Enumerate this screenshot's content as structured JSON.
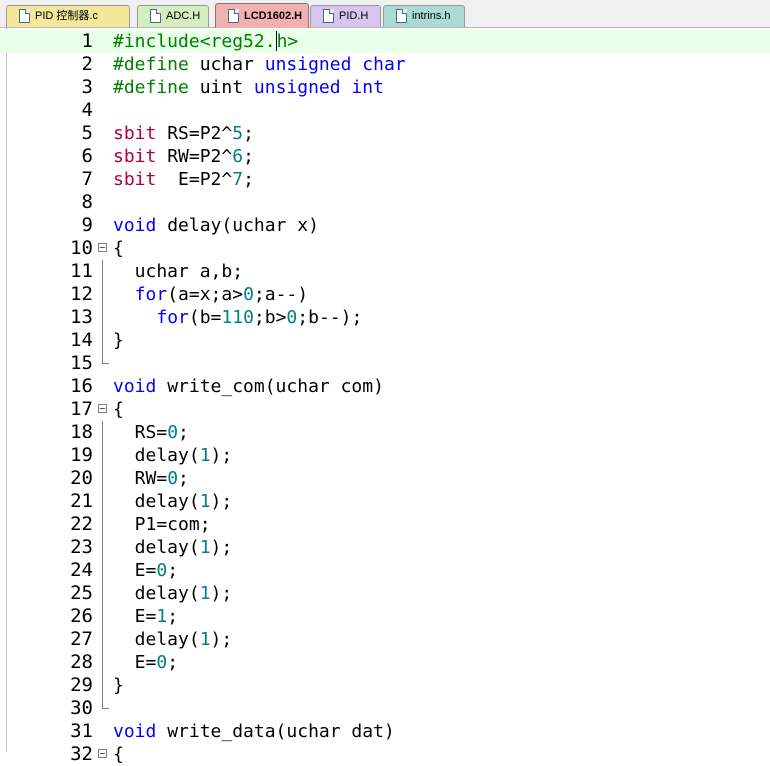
{
  "tabs": [
    {
      "label": "PID 控制器.c",
      "color": "#f4e79a",
      "active": false
    },
    {
      "label": "ADC.H",
      "color": "#d4eec0",
      "active": false
    },
    {
      "label": "LCD1602.H",
      "color": "#f2b0b0",
      "active": true
    },
    {
      "label": "PID.H",
      "color": "#d8c4ee",
      "active": false
    },
    {
      "label": "intrins.h",
      "color": "#a8dcd4",
      "active": false
    }
  ],
  "editor": {
    "current_line": 1,
    "lines": [
      {
        "n": "1",
        "fold": "",
        "tokens": [
          [
            "pre",
            "#include<reg52."
          ],
          [
            "caret",
            ""
          ],
          [
            "pre",
            "h>"
          ]
        ]
      },
      {
        "n": "2",
        "fold": "",
        "tokens": [
          [
            "pre",
            "#define "
          ],
          [
            "plain",
            "uchar "
          ],
          [
            "kw",
            "unsigned char"
          ]
        ]
      },
      {
        "n": "3",
        "fold": "",
        "tokens": [
          [
            "pre",
            "#define "
          ],
          [
            "plain",
            "uint "
          ],
          [
            "kw",
            "unsigned int"
          ]
        ]
      },
      {
        "n": "4",
        "fold": "",
        "tokens": []
      },
      {
        "n": "5",
        "fold": "",
        "tokens": [
          [
            "type",
            "sbit "
          ],
          [
            "plain",
            "RS=P2^"
          ],
          [
            "num",
            "5"
          ],
          [
            "plain",
            ";"
          ]
        ]
      },
      {
        "n": "6",
        "fold": "",
        "tokens": [
          [
            "type",
            "sbit "
          ],
          [
            "plain",
            "RW=P2^"
          ],
          [
            "num",
            "6"
          ],
          [
            "plain",
            ";"
          ]
        ]
      },
      {
        "n": "7",
        "fold": "",
        "tokens": [
          [
            "type",
            "sbit "
          ],
          [
            "plain",
            " E=P2^"
          ],
          [
            "num",
            "7"
          ],
          [
            "plain",
            ";"
          ]
        ]
      },
      {
        "n": "8",
        "fold": "",
        "tokens": []
      },
      {
        "n": "9",
        "fold": "",
        "tokens": [
          [
            "kw",
            "void "
          ],
          [
            "plain",
            "delay(uchar x)"
          ]
        ]
      },
      {
        "n": "10",
        "fold": "open",
        "tokens": [
          [
            "plain",
            "{"
          ]
        ]
      },
      {
        "n": "11",
        "fold": "line",
        "tokens": [
          [
            "plain",
            "  uchar a,b;"
          ]
        ]
      },
      {
        "n": "12",
        "fold": "line",
        "tokens": [
          [
            "plain",
            "  "
          ],
          [
            "kw",
            "for"
          ],
          [
            "plain",
            "(a=x;a>"
          ],
          [
            "num",
            "0"
          ],
          [
            "plain",
            ";a--)"
          ]
        ]
      },
      {
        "n": "13",
        "fold": "line",
        "tokens": [
          [
            "plain",
            "    "
          ],
          [
            "kw",
            "for"
          ],
          [
            "plain",
            "(b="
          ],
          [
            "num",
            "110"
          ],
          [
            "plain",
            ";b>"
          ],
          [
            "num",
            "0"
          ],
          [
            "plain",
            ";b--);"
          ]
        ]
      },
      {
        "n": "14",
        "fold": "line",
        "tokens": [
          [
            "plain",
            "}"
          ]
        ]
      },
      {
        "n": "15",
        "fold": "end",
        "tokens": []
      },
      {
        "n": "16",
        "fold": "",
        "tokens": [
          [
            "kw",
            "void "
          ],
          [
            "plain",
            "write_com(uchar com)"
          ]
        ]
      },
      {
        "n": "17",
        "fold": "open",
        "tokens": [
          [
            "plain",
            "{"
          ]
        ]
      },
      {
        "n": "18",
        "fold": "line",
        "tokens": [
          [
            "plain",
            "  RS="
          ],
          [
            "num",
            "0"
          ],
          [
            "plain",
            ";"
          ]
        ]
      },
      {
        "n": "19",
        "fold": "line",
        "tokens": [
          [
            "plain",
            "  delay("
          ],
          [
            "num",
            "1"
          ],
          [
            "plain",
            ");"
          ]
        ]
      },
      {
        "n": "20",
        "fold": "line",
        "tokens": [
          [
            "plain",
            "  RW="
          ],
          [
            "num",
            "0"
          ],
          [
            "plain",
            ";"
          ]
        ]
      },
      {
        "n": "21",
        "fold": "line",
        "tokens": [
          [
            "plain",
            "  delay("
          ],
          [
            "num",
            "1"
          ],
          [
            "plain",
            ");"
          ]
        ]
      },
      {
        "n": "22",
        "fold": "line",
        "tokens": [
          [
            "plain",
            "  P1=com;"
          ]
        ]
      },
      {
        "n": "23",
        "fold": "line",
        "tokens": [
          [
            "plain",
            "  delay("
          ],
          [
            "num",
            "1"
          ],
          [
            "plain",
            ");"
          ]
        ]
      },
      {
        "n": "24",
        "fold": "line",
        "tokens": [
          [
            "plain",
            "  E="
          ],
          [
            "num",
            "0"
          ],
          [
            "plain",
            ";"
          ]
        ]
      },
      {
        "n": "25",
        "fold": "line",
        "tokens": [
          [
            "plain",
            "  delay("
          ],
          [
            "num",
            "1"
          ],
          [
            "plain",
            ");"
          ]
        ]
      },
      {
        "n": "26",
        "fold": "line",
        "tokens": [
          [
            "plain",
            "  E="
          ],
          [
            "num",
            "1"
          ],
          [
            "plain",
            ";"
          ]
        ]
      },
      {
        "n": "27",
        "fold": "line",
        "tokens": [
          [
            "plain",
            "  delay("
          ],
          [
            "num",
            "1"
          ],
          [
            "plain",
            ");"
          ]
        ]
      },
      {
        "n": "28",
        "fold": "line",
        "tokens": [
          [
            "plain",
            "  E="
          ],
          [
            "num",
            "0"
          ],
          [
            "plain",
            ";"
          ]
        ]
      },
      {
        "n": "29",
        "fold": "line",
        "tokens": [
          [
            "plain",
            "}"
          ]
        ]
      },
      {
        "n": "30",
        "fold": "end",
        "tokens": []
      },
      {
        "n": "31",
        "fold": "",
        "tokens": [
          [
            "kw",
            "void "
          ],
          [
            "plain",
            "write_data(uchar dat)"
          ]
        ]
      },
      {
        "n": "32",
        "fold": "open",
        "tokens": [
          [
            "plain",
            "{"
          ]
        ]
      }
    ]
  }
}
